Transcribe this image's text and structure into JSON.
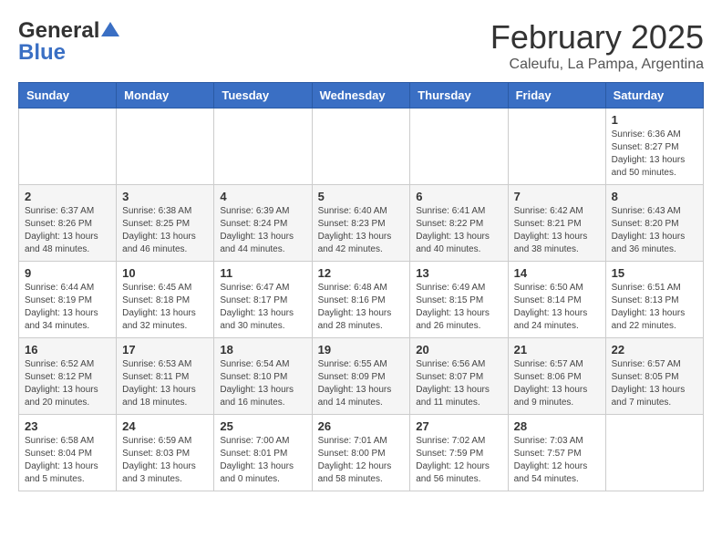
{
  "header": {
    "logo_line1": "General",
    "logo_line2": "Blue",
    "month_title": "February 2025",
    "subtitle": "Caleufu, La Pampa, Argentina"
  },
  "weekdays": [
    "Sunday",
    "Monday",
    "Tuesday",
    "Wednesday",
    "Thursday",
    "Friday",
    "Saturday"
  ],
  "weeks": [
    [
      {
        "day": "",
        "info": ""
      },
      {
        "day": "",
        "info": ""
      },
      {
        "day": "",
        "info": ""
      },
      {
        "day": "",
        "info": ""
      },
      {
        "day": "",
        "info": ""
      },
      {
        "day": "",
        "info": ""
      },
      {
        "day": "1",
        "info": "Sunrise: 6:36 AM\nSunset: 8:27 PM\nDaylight: 13 hours\nand 50 minutes."
      }
    ],
    [
      {
        "day": "2",
        "info": "Sunrise: 6:37 AM\nSunset: 8:26 PM\nDaylight: 13 hours\nand 48 minutes."
      },
      {
        "day": "3",
        "info": "Sunrise: 6:38 AM\nSunset: 8:25 PM\nDaylight: 13 hours\nand 46 minutes."
      },
      {
        "day": "4",
        "info": "Sunrise: 6:39 AM\nSunset: 8:24 PM\nDaylight: 13 hours\nand 44 minutes."
      },
      {
        "day": "5",
        "info": "Sunrise: 6:40 AM\nSunset: 8:23 PM\nDaylight: 13 hours\nand 42 minutes."
      },
      {
        "day": "6",
        "info": "Sunrise: 6:41 AM\nSunset: 8:22 PM\nDaylight: 13 hours\nand 40 minutes."
      },
      {
        "day": "7",
        "info": "Sunrise: 6:42 AM\nSunset: 8:21 PM\nDaylight: 13 hours\nand 38 minutes."
      },
      {
        "day": "8",
        "info": "Sunrise: 6:43 AM\nSunset: 8:20 PM\nDaylight: 13 hours\nand 36 minutes."
      }
    ],
    [
      {
        "day": "9",
        "info": "Sunrise: 6:44 AM\nSunset: 8:19 PM\nDaylight: 13 hours\nand 34 minutes."
      },
      {
        "day": "10",
        "info": "Sunrise: 6:45 AM\nSunset: 8:18 PM\nDaylight: 13 hours\nand 32 minutes."
      },
      {
        "day": "11",
        "info": "Sunrise: 6:47 AM\nSunset: 8:17 PM\nDaylight: 13 hours\nand 30 minutes."
      },
      {
        "day": "12",
        "info": "Sunrise: 6:48 AM\nSunset: 8:16 PM\nDaylight: 13 hours\nand 28 minutes."
      },
      {
        "day": "13",
        "info": "Sunrise: 6:49 AM\nSunset: 8:15 PM\nDaylight: 13 hours\nand 26 minutes."
      },
      {
        "day": "14",
        "info": "Sunrise: 6:50 AM\nSunset: 8:14 PM\nDaylight: 13 hours\nand 24 minutes."
      },
      {
        "day": "15",
        "info": "Sunrise: 6:51 AM\nSunset: 8:13 PM\nDaylight: 13 hours\nand 22 minutes."
      }
    ],
    [
      {
        "day": "16",
        "info": "Sunrise: 6:52 AM\nSunset: 8:12 PM\nDaylight: 13 hours\nand 20 minutes."
      },
      {
        "day": "17",
        "info": "Sunrise: 6:53 AM\nSunset: 8:11 PM\nDaylight: 13 hours\nand 18 minutes."
      },
      {
        "day": "18",
        "info": "Sunrise: 6:54 AM\nSunset: 8:10 PM\nDaylight: 13 hours\nand 16 minutes."
      },
      {
        "day": "19",
        "info": "Sunrise: 6:55 AM\nSunset: 8:09 PM\nDaylight: 13 hours\nand 14 minutes."
      },
      {
        "day": "20",
        "info": "Sunrise: 6:56 AM\nSunset: 8:07 PM\nDaylight: 13 hours\nand 11 minutes."
      },
      {
        "day": "21",
        "info": "Sunrise: 6:57 AM\nSunset: 8:06 PM\nDaylight: 13 hours\nand 9 minutes."
      },
      {
        "day": "22",
        "info": "Sunrise: 6:57 AM\nSunset: 8:05 PM\nDaylight: 13 hours\nand 7 minutes."
      }
    ],
    [
      {
        "day": "23",
        "info": "Sunrise: 6:58 AM\nSunset: 8:04 PM\nDaylight: 13 hours\nand 5 minutes."
      },
      {
        "day": "24",
        "info": "Sunrise: 6:59 AM\nSunset: 8:03 PM\nDaylight: 13 hours\nand 3 minutes."
      },
      {
        "day": "25",
        "info": "Sunrise: 7:00 AM\nSunset: 8:01 PM\nDaylight: 13 hours\nand 0 minutes."
      },
      {
        "day": "26",
        "info": "Sunrise: 7:01 AM\nSunset: 8:00 PM\nDaylight: 12 hours\nand 58 minutes."
      },
      {
        "day": "27",
        "info": "Sunrise: 7:02 AM\nSunset: 7:59 PM\nDaylight: 12 hours\nand 56 minutes."
      },
      {
        "day": "28",
        "info": "Sunrise: 7:03 AM\nSunset: 7:57 PM\nDaylight: 12 hours\nand 54 minutes."
      },
      {
        "day": "",
        "info": ""
      }
    ]
  ]
}
